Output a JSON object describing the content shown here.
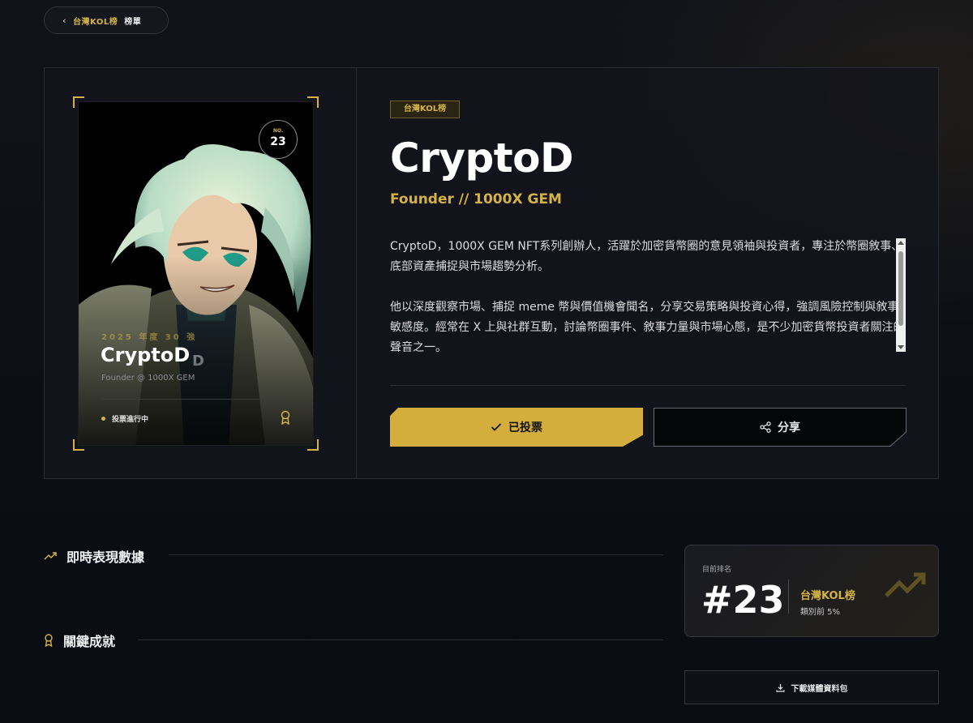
{
  "nav": {
    "back_label_gold": "台灣KOL榜",
    "back_label_white": "榜單"
  },
  "card": {
    "no_label": "NO.",
    "number": "23",
    "year_label": "2025 年度 30 強",
    "name": "CryptoD",
    "role": "Founder @ 1000X GEM",
    "status": "投票進行中"
  },
  "profile": {
    "tag": "台灣KOL榜",
    "name": "CryptoD",
    "role": "Founder // 1000X GEM",
    "bio_paragraphs": [
      "CryptoD，1000X GEM NFT系列創辦人，活躍於加密貨幣圈的意見領袖與投資者，專注於幣圈敘事、底部資產捕捉與市場趨勢分析。",
      "他以深度觀察市場、捕捉 meme 幣與價值機會聞名，分享交易策略與投資心得，強調風險控制與敘事敏感度。經常在 X 上與社群互動，討論幣圈事件、敘事力量與市場心態，是不少加密貨幣投資者關注的聲音之一。"
    ]
  },
  "actions": {
    "voted_label": "已投票",
    "share_label": "分享"
  },
  "sections": {
    "performance_title": "即時表現數據",
    "achievements_title": "關鍵成就"
  },
  "rank": {
    "label": "目前排名",
    "value": "#23",
    "category": "台灣KOL榜",
    "percentile": "類別前 5%"
  },
  "download": {
    "label": "下載媒體資料包"
  },
  "colors": {
    "accent_gold": "#d4b246",
    "background": "#0d0f17",
    "panel_border": "#2a2c35"
  },
  "icons": [
    "chevron-left-icon",
    "award-icon",
    "check-icon",
    "share-icon",
    "trending-up-icon",
    "download-icon"
  ]
}
